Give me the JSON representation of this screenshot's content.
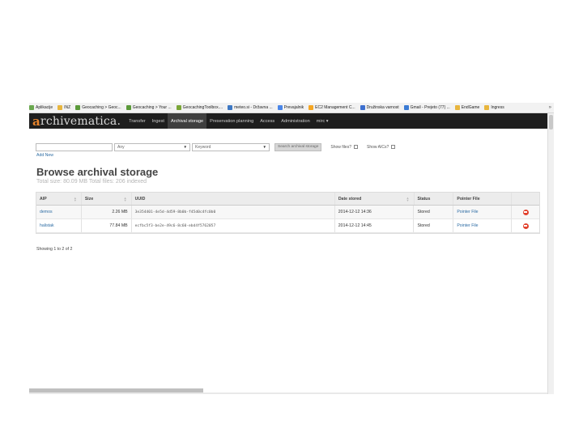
{
  "bookmarks": [
    {
      "label": "Aplikacije",
      "icon": "apps-icon",
      "color": "#6aa84f"
    },
    {
      "label": "INZ",
      "icon": "folder-icon",
      "color": "#e8b63e"
    },
    {
      "label": "Geocaching > Geoc...",
      "icon": "geocaching-icon",
      "color": "#5b9a3a"
    },
    {
      "label": "Geocaching > Your ...",
      "icon": "geocaching-icon",
      "color": "#5b9a3a"
    },
    {
      "label": "GeocachingToolbox....",
      "icon": "toolbox-icon",
      "color": "#7aa637"
    },
    {
      "label": "meteo.si - Državna ...",
      "icon": "meteo-icon",
      "color": "#3d78c4"
    },
    {
      "label": "Prevajalnik",
      "icon": "translate-icon",
      "color": "#4a86e8"
    },
    {
      "label": "EC2 Management C...",
      "icon": "aws-icon",
      "color": "#f5a623"
    },
    {
      "label": "Družinska varnost",
      "icon": "family-icon",
      "color": "#3d6fcf"
    },
    {
      "label": "Gmail - Prejeto (77) ...",
      "icon": "gmail-icon",
      "color": "#3b7bd4"
    },
    {
      "label": "EndGame",
      "icon": "folder-icon",
      "color": "#e8b63e"
    },
    {
      "label": "Ingress",
      "icon": "folder-icon",
      "color": "#e8b63e"
    }
  ],
  "bookmarks_more": "»",
  "brand": {
    "first_letter": "a",
    "rest": "rchivematica."
  },
  "nav": [
    {
      "label": "Transfer",
      "active": false
    },
    {
      "label": "Ingest",
      "active": false
    },
    {
      "label": "Archival storage",
      "active": true
    },
    {
      "label": "Preservation planning",
      "active": false
    },
    {
      "label": "Access",
      "active": false
    },
    {
      "label": "Administration",
      "active": false
    },
    {
      "label": "mirc ▾",
      "active": false
    }
  ],
  "search": {
    "query_value": "",
    "field_select": "Any",
    "type_select": "Keyword",
    "button_label": "Search archival storage",
    "show_files_label": "Show files?",
    "show_aics_label": "Show AICs?",
    "add_new_label": "Add New"
  },
  "page": {
    "title": "Browse archival storage",
    "subtitle": "Total size: 80.09 MB   Total files: 206 indexed"
  },
  "table": {
    "headers": {
      "aip": "AIP",
      "size": "Size",
      "uuid": "UUID",
      "date": "Date stored",
      "status": "Status",
      "pointer": "Pointer File"
    },
    "rows": [
      {
        "aip": "demos",
        "size": "2.26 MB",
        "uuid": "3e354401-4e5d-4d59-8b0b-f45d0c4fc0b0",
        "date": "2014-12-12 14:36",
        "status": "Stored",
        "pointer": "Pointer File"
      },
      {
        "aip": "halistak",
        "size": "77.84 MB",
        "uuid": "ecfbc5f3-be2e-49c6-8c60-ebd4f5762057",
        "date": "2014-12-12 14:45",
        "status": "Stored",
        "pointer": "Pointer File"
      }
    ]
  },
  "footer": {
    "showing": "Showing 1 to 2 of 2"
  },
  "colors": {
    "navbar": "#1e1e1e",
    "brand_accent": "#e7842c",
    "link": "#2e6da4",
    "delete": "#e2422e"
  }
}
